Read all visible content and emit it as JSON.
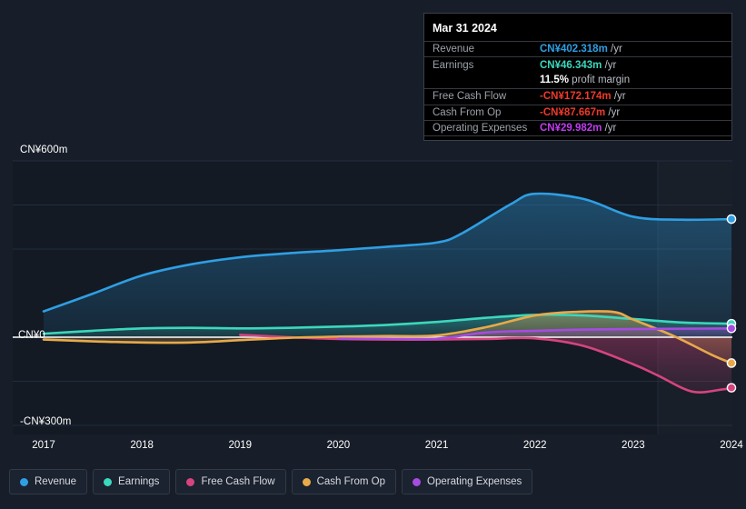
{
  "chart_data": {
    "type": "area",
    "title": "",
    "xlabel": "",
    "ylabel": "",
    "currency": "CN¥",
    "grid": true,
    "legend_position": "bottom",
    "x": [
      2017,
      2018,
      2019,
      2020,
      2021,
      2022,
      2023,
      2024
    ],
    "xtick_labels": [
      "2017",
      "2018",
      "2019",
      "2020",
      "2021",
      "2022",
      "2023",
      "2024"
    ],
    "ytick_labels": [
      "CN¥600m",
      "CN¥0",
      "-CN¥300m"
    ],
    "ylim": [
      -330,
      630
    ],
    "zero_line": 0,
    "gridline_values": [
      600,
      450,
      300,
      0,
      -150,
      -300
    ],
    "forecast_start_x": 2023.25,
    "series": [
      {
        "name": "Revenue",
        "key": "revenue",
        "color": "#2f9fe3",
        "fill": "rgba(47,123,180,0.30)",
        "x": [
          2017,
          2017.5,
          2018,
          2018.5,
          2019,
          2019.5,
          2020,
          2020.5,
          2021,
          2021.25,
          2021.75,
          2022,
          2022.5,
          2023,
          2023.5,
          2024
        ],
        "values": [
          88,
          148,
          210,
          248,
          272,
          286,
          296,
          308,
          322,
          352,
          452,
          488,
          470,
          410,
          400,
          402
        ]
      },
      {
        "name": "Earnings",
        "key": "earnings",
        "color": "#3cd7bd",
        "fill": "rgba(60,160,150,0.30)",
        "x": [
          2017,
          2017.5,
          2018,
          2018.5,
          2019,
          2019.5,
          2020,
          2020.5,
          2021,
          2021.5,
          2022,
          2022.5,
          2023,
          2023.5,
          2024
        ],
        "values": [
          12,
          22,
          30,
          32,
          30,
          32,
          36,
          42,
          52,
          66,
          76,
          74,
          62,
          50,
          46
        ]
      },
      {
        "name": "Free Cash Flow",
        "key": "free_cash_flow",
        "color": "#d6447e",
        "fill": "rgba(150,50,70,0.32)",
        "x": [
          2019,
          2019.5,
          2020,
          2020.5,
          2021,
          2021.5,
          2022,
          2022.5,
          2023,
          2023.25,
          2023.6,
          2023.9,
          2024
        ],
        "values": [
          8,
          0,
          -6,
          -8,
          -8,
          -6,
          -4,
          -30,
          -92,
          -130,
          -185,
          -178,
          -172
        ]
      },
      {
        "name": "Cash From Op",
        "key": "cash_from_op",
        "color": "#e8a94a",
        "fill": "rgba(150,120,60,0.30)",
        "x": [
          2017,
          2017.5,
          2018,
          2018.5,
          2019,
          2019.5,
          2020,
          2020.5,
          2021,
          2021.5,
          2022,
          2022.4,
          2022.8,
          2023,
          2023.4,
          2023.8,
          2024
        ],
        "values": [
          -8,
          -14,
          -18,
          -18,
          -10,
          -2,
          2,
          4,
          6,
          34,
          74,
          86,
          86,
          60,
          6,
          -60,
          -88
        ]
      },
      {
        "name": "Operating Expenses",
        "key": "operating_expenses",
        "color": "#a64ce0",
        "fill": "rgba(120,60,180,0.28)",
        "x": [
          2020,
          2020.5,
          2021,
          2021.5,
          2022,
          2022.5,
          2023,
          2023.5,
          2024
        ],
        "values": [
          -5,
          -5,
          -5,
          16,
          22,
          26,
          28,
          29,
          30
        ]
      }
    ]
  },
  "tooltip": {
    "date": "Mar 31 2024",
    "rows": [
      {
        "label": "Revenue",
        "value": "CN¥402.318m",
        "unit": "/yr",
        "color": "#2f9fe3"
      },
      {
        "label": "Earnings",
        "value": "CN¥46.343m",
        "unit": "/yr",
        "color": "#3cd7bd"
      },
      {
        "label": "",
        "value": "11.5%",
        "unit": "profit margin",
        "color": "#ffffff",
        "is_margin": true
      },
      {
        "label": "Free Cash Flow",
        "value": "-CN¥172.174m",
        "unit": "/yr",
        "color": "#f0392b"
      },
      {
        "label": "Cash From Op",
        "value": "-CN¥87.667m",
        "unit": "/yr",
        "color": "#f0392b"
      },
      {
        "label": "Operating Expenses",
        "value": "CN¥29.982m",
        "unit": "/yr",
        "color": "#c03cf0"
      }
    ]
  },
  "legend": {
    "items": [
      {
        "label": "Revenue",
        "color": "#2f9fe3"
      },
      {
        "label": "Earnings",
        "color": "#3cd7bd"
      },
      {
        "label": "Free Cash Flow",
        "color": "#d6447e"
      },
      {
        "label": "Cash From Op",
        "color": "#e8a94a"
      },
      {
        "label": "Operating Expenses",
        "color": "#a64ce0"
      }
    ]
  },
  "colors": {
    "background": "#171e29",
    "plot_background": "#131a24",
    "grid": "#2b3748",
    "zero_line": "#ffffff",
    "tooltip_background": "#000000"
  }
}
